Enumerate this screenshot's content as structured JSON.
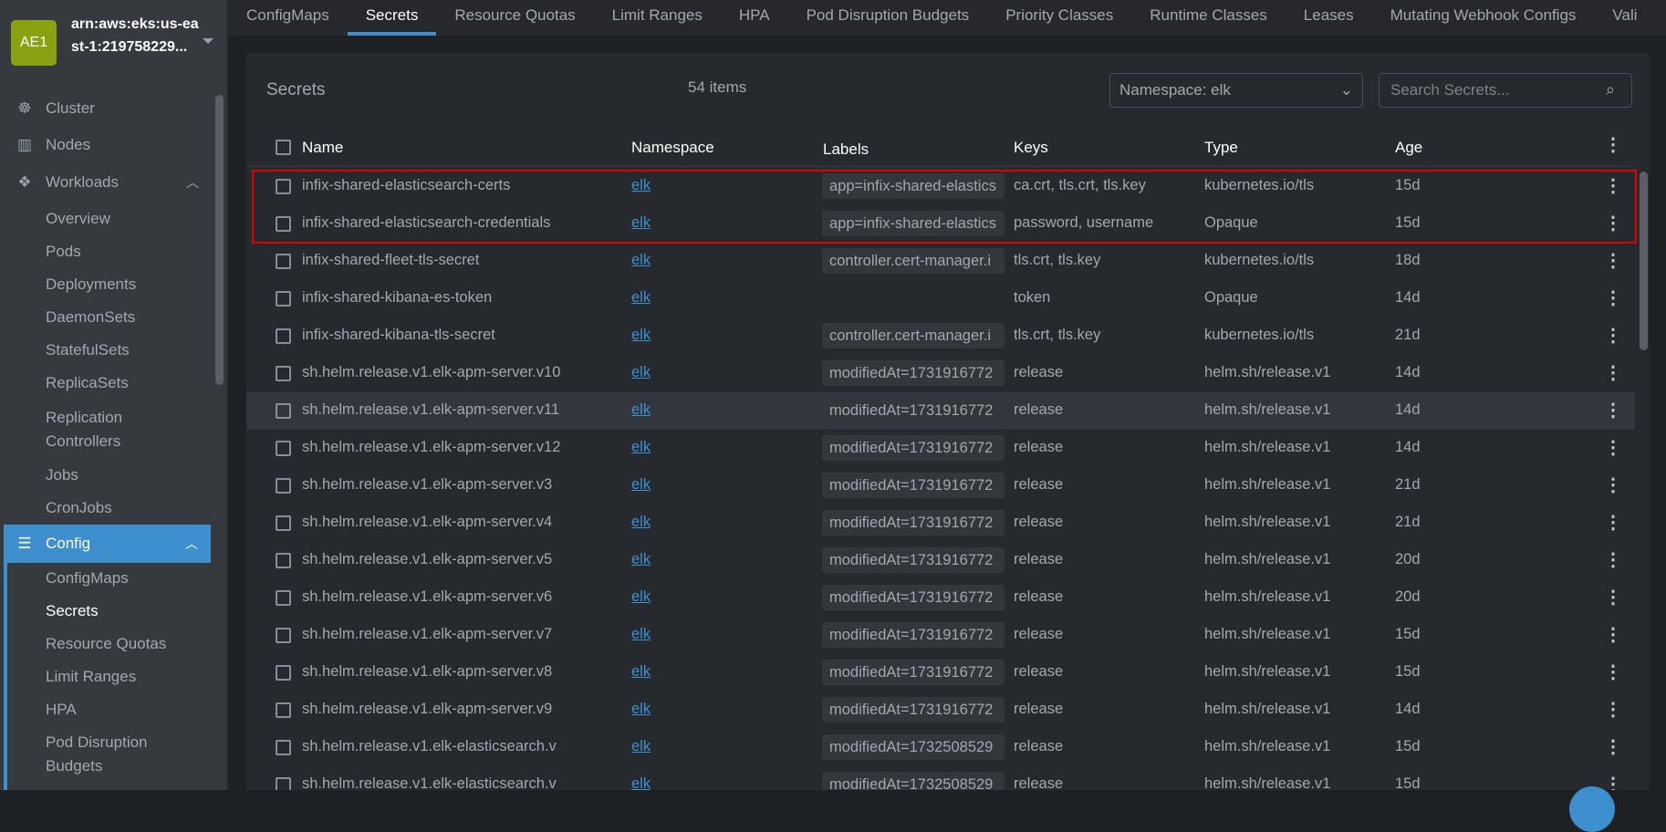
{
  "sidebar": {
    "cluster": {
      "avatar": "AE1",
      "name": "arn:aws:eks:us-east-1:219758229..."
    },
    "items": [
      {
        "label": "Cluster",
        "icon": "helm-wheel-icon",
        "glyph": "☸"
      },
      {
        "label": "Nodes",
        "icon": "nodes-icon",
        "glyph": "▥"
      },
      {
        "label": "Workloads",
        "icon": "cubes-icon",
        "glyph": "❖",
        "expanded": true
      }
    ],
    "workloads": [
      "Overview",
      "Pods",
      "Deployments",
      "DaemonSets",
      "StatefulSets",
      "ReplicaSets",
      "Replication Controllers",
      "Jobs",
      "CronJobs"
    ],
    "config": {
      "label": "Config",
      "icon": "list-icon",
      "glyph": "☰"
    },
    "config_items": [
      "ConfigMaps",
      "Secrets",
      "Resource Quotas",
      "Limit Ranges",
      "HPA",
      "Pod Disruption Budgets"
    ],
    "active": "Secrets"
  },
  "tabs": [
    "ConfigMaps",
    "Secrets",
    "Resource Quotas",
    "Limit Ranges",
    "HPA",
    "Pod Disruption Budgets",
    "Priority Classes",
    "Runtime Classes",
    "Leases",
    "Mutating Webhook Configs",
    "Vali"
  ],
  "active_tab": "Secrets",
  "panel": {
    "title": "Secrets",
    "count": "54 items",
    "namespace": "Namespace: elk",
    "search_placeholder": "Search Secrets..."
  },
  "columns": [
    "Name",
    "Namespace",
    "Labels",
    "Keys",
    "Type",
    "Age"
  ],
  "rows": [
    {
      "name": "infix-shared-elasticsearch-certs",
      "ns": "elk",
      "labels": "app=infix-shared-elastics",
      "keys": "ca.crt, tls.crt, tls.key",
      "type": "kubernetes.io/tls",
      "age": "15d"
    },
    {
      "name": "infix-shared-elasticsearch-credentials",
      "ns": "elk",
      "labels": "app=infix-shared-elastics",
      "keys": "password, username",
      "type": "Opaque",
      "age": "15d"
    },
    {
      "name": "infix-shared-fleet-tls-secret",
      "ns": "elk",
      "labels": "controller.cert-manager.i",
      "keys": "tls.crt, tls.key",
      "type": "kubernetes.io/tls",
      "age": "18d"
    },
    {
      "name": "infix-shared-kibana-es-token",
      "ns": "elk",
      "labels": "",
      "keys": "token",
      "type": "Opaque",
      "age": "14d"
    },
    {
      "name": "infix-shared-kibana-tls-secret",
      "ns": "elk",
      "labels": "controller.cert-manager.i",
      "keys": "tls.crt, tls.key",
      "type": "kubernetes.io/tls",
      "age": "21d"
    },
    {
      "name": "sh.helm.release.v1.elk-apm-server.v10",
      "ns": "elk",
      "labels": "modifiedAt=1731916772",
      "keys": "release",
      "type": "helm.sh/release.v1",
      "age": "14d"
    },
    {
      "name": "sh.helm.release.v1.elk-apm-server.v11",
      "ns": "elk",
      "labels": "modifiedAt=1731916772",
      "keys": "release",
      "type": "helm.sh/release.v1",
      "age": "14d"
    },
    {
      "name": "sh.helm.release.v1.elk-apm-server.v12",
      "ns": "elk",
      "labels": "modifiedAt=1731916772",
      "keys": "release",
      "type": "helm.sh/release.v1",
      "age": "14d"
    },
    {
      "name": "sh.helm.release.v1.elk-apm-server.v3",
      "ns": "elk",
      "labels": "modifiedAt=1731916772",
      "keys": "release",
      "type": "helm.sh/release.v1",
      "age": "21d"
    },
    {
      "name": "sh.helm.release.v1.elk-apm-server.v4",
      "ns": "elk",
      "labels": "modifiedAt=1731916772",
      "keys": "release",
      "type": "helm.sh/release.v1",
      "age": "21d"
    },
    {
      "name": "sh.helm.release.v1.elk-apm-server.v5",
      "ns": "elk",
      "labels": "modifiedAt=1731916772",
      "keys": "release",
      "type": "helm.sh/release.v1",
      "age": "20d"
    },
    {
      "name": "sh.helm.release.v1.elk-apm-server.v6",
      "ns": "elk",
      "labels": "modifiedAt=1731916772",
      "keys": "release",
      "type": "helm.sh/release.v1",
      "age": "20d"
    },
    {
      "name": "sh.helm.release.v1.elk-apm-server.v7",
      "ns": "elk",
      "labels": "modifiedAt=1731916772",
      "keys": "release",
      "type": "helm.sh/release.v1",
      "age": "15d"
    },
    {
      "name": "sh.helm.release.v1.elk-apm-server.v8",
      "ns": "elk",
      "labels": "modifiedAt=1731916772",
      "keys": "release",
      "type": "helm.sh/release.v1",
      "age": "15d"
    },
    {
      "name": "sh.helm.release.v1.elk-apm-server.v9",
      "ns": "elk",
      "labels": "modifiedAt=1731916772",
      "keys": "release",
      "type": "helm.sh/release.v1",
      "age": "14d"
    },
    {
      "name": "sh.helm.release.v1.elk-elasticsearch.v",
      "ns": "elk",
      "labels": "modifiedAt=1732508529",
      "keys": "release",
      "type": "helm.sh/release.v1",
      "age": "15d"
    },
    {
      "name": "sh.helm.release.v1.elk-elasticsearch.v",
      "ns": "elk",
      "labels": "modifiedAt=1732508529",
      "keys": "release",
      "type": "helm.sh/release.v1",
      "age": "15d"
    }
  ],
  "hover_row": 6,
  "colors": {
    "accent": "#3d8fcd",
    "avatar": "#8aa212",
    "highlight": "#e00000"
  }
}
